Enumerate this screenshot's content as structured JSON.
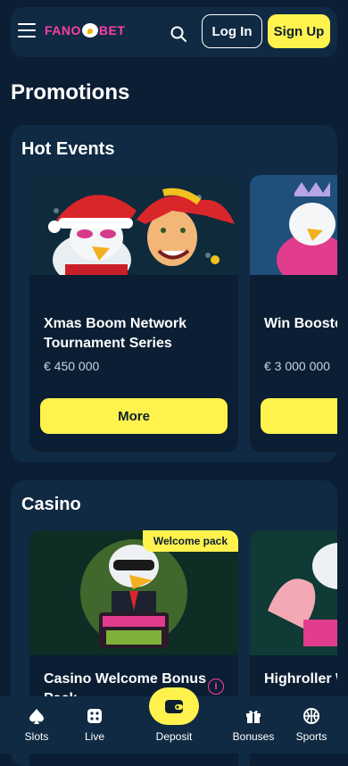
{
  "header": {
    "logo_text": "FANOBET",
    "login_label": "Log In",
    "signup_label": "Sign Up"
  },
  "page_title": "Promotions",
  "sections": [
    {
      "title": "Hot Events",
      "cards": [
        {
          "title": "Xmas Boom Network Tournament Series",
          "amount": "€ 450 000",
          "button": "More"
        },
        {
          "title": "Win Booste",
          "amount": "€ 3 000 000"
        }
      ]
    },
    {
      "title": "Casino",
      "cards": [
        {
          "title": "Casino Welcome Bonus Pack",
          "badge": "Welcome pack"
        },
        {
          "title": "Highroller W"
        }
      ]
    }
  ],
  "bottom_nav": {
    "slots": "Slots",
    "live": "Live",
    "deposit": "Deposit",
    "bonuses": "Bonuses",
    "sports": "Sports"
  },
  "colors": {
    "background": "#0b1e33",
    "panel": "#102a43",
    "accent_yellow": "#fff24d",
    "brand_pink": "#ff3ea5"
  }
}
